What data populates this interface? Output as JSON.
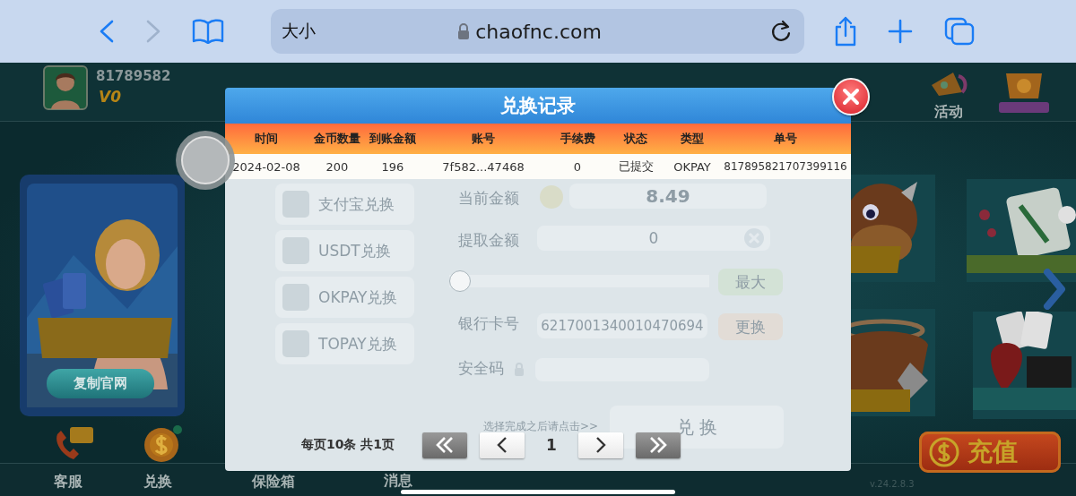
{
  "browser": {
    "nav_buttons": [
      {
        "kind": "back",
        "disabled": false
      },
      {
        "kind": "forward",
        "disabled": true
      }
    ],
    "text_size_button": "大小",
    "address": "chaofnc.com"
  },
  "game": {
    "user_id": "81789582",
    "vip": "V0",
    "activity": "活动",
    "copy_site_button": "复制官网",
    "bottom_nav": [
      {
        "kind": "service",
        "label": "客服"
      },
      {
        "kind": "exchange",
        "label": "兑换"
      },
      {
        "kind": "safe",
        "label": "保险箱"
      },
      {
        "kind": "message",
        "label": "消息"
      }
    ],
    "recharge_button": "充值",
    "version": "v.24.2.8.3"
  },
  "exchange_form": {
    "menu": [
      "支付宝兑换",
      "USDT兑换",
      "OKPAY兑换",
      "TOPAY兑换"
    ],
    "current_label": "当前金额",
    "current_value": "8.49",
    "amount_label": "提取金额",
    "amount_value": "0",
    "max_button": "最大",
    "slider": {
      "level": 0
    },
    "card_label": "银行卡号",
    "card_value": "6217001340010470694",
    "change_button": "更换",
    "code_label": "安全码",
    "hint": "选择完成之后请点击>>",
    "submit_button": "兑 换"
  },
  "modal": {
    "title": "兑换记录",
    "columns": [
      "时间",
      "金币数量",
      "到账金额",
      "账号",
      "手续费",
      "状态",
      "类型",
      "单号"
    ],
    "rows": [
      [
        "2024-02-08",
        "200",
        "196",
        "7f582...47468",
        "0",
        "已提交",
        "OKPAY",
        "817895821707399116"
      ]
    ],
    "page_info": "每页10条 共1页",
    "current_page": "1"
  }
}
